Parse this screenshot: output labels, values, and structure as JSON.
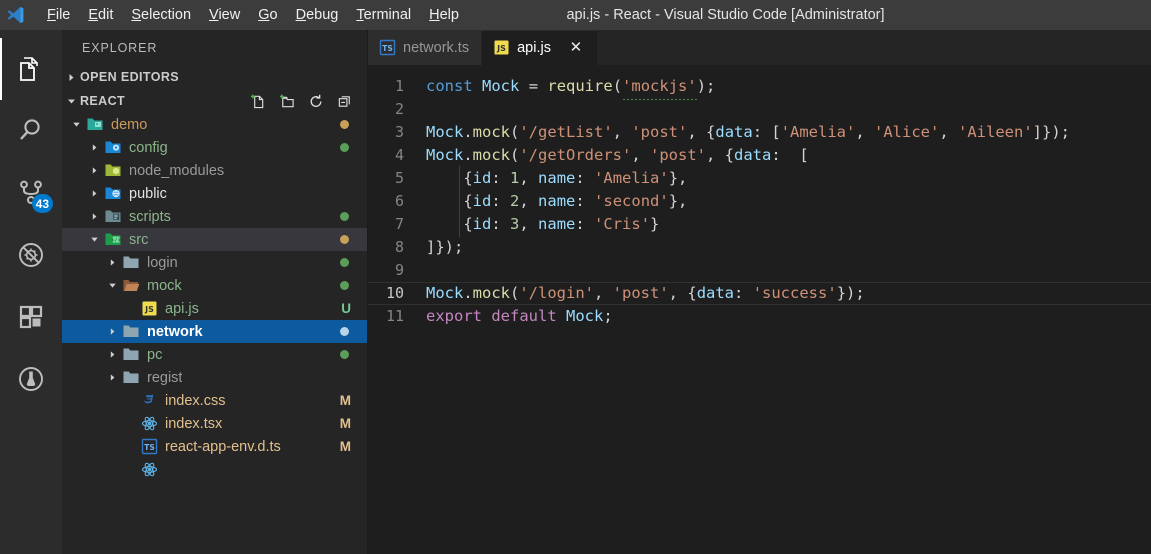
{
  "window": {
    "title": "api.js - React - Visual Studio Code [Administrator]",
    "logo_icon": "vscode-logo-icon"
  },
  "menubar": {
    "items": [
      {
        "label": "File",
        "accel": "F"
      },
      {
        "label": "Edit",
        "accel": "E"
      },
      {
        "label": "Selection",
        "accel": "S"
      },
      {
        "label": "View",
        "accel": "V"
      },
      {
        "label": "Go",
        "accel": "G"
      },
      {
        "label": "Debug",
        "accel": "D"
      },
      {
        "label": "Terminal",
        "accel": "T"
      },
      {
        "label": "Help",
        "accel": "H"
      }
    ]
  },
  "activitybar": {
    "items": [
      {
        "name": "explorer-icon",
        "tooltip": "Explorer",
        "active": true,
        "badge": ""
      },
      {
        "name": "search-icon",
        "tooltip": "Search",
        "active": false,
        "badge": ""
      },
      {
        "name": "source-control-icon",
        "tooltip": "Source Control",
        "active": false,
        "badge": "43"
      },
      {
        "name": "debug-disabled-icon",
        "tooltip": "Debug",
        "active": false,
        "badge": ""
      },
      {
        "name": "extensions-icon",
        "tooltip": "Extensions",
        "active": false,
        "badge": ""
      },
      {
        "name": "test-beaker-icon",
        "tooltip": "Test",
        "active": false,
        "badge": ""
      }
    ],
    "badge_color": "#007acc"
  },
  "sidebar": {
    "title": "EXPLORER",
    "sections": [
      {
        "label": "OPEN EDITORS",
        "expanded": false
      },
      {
        "label": "REACT",
        "expanded": true
      }
    ],
    "section_actions": [
      {
        "name": "new-file-icon",
        "tooltip": "New File"
      },
      {
        "name": "new-folder-icon",
        "tooltip": "New Folder"
      },
      {
        "name": "refresh-icon",
        "tooltip": "Refresh Explorer"
      },
      {
        "name": "collapse-all-icon",
        "tooltip": "Collapse Folders in Explorer"
      }
    ],
    "tree": [
      {
        "label": "demo",
        "type": "folder",
        "icon": "folder-demo-icon",
        "indent": 1,
        "expanded": true,
        "color": "#c99a5b",
        "dot": "#c8a05a",
        "status": ""
      },
      {
        "label": "config",
        "type": "folder",
        "icon": "folder-config-icon",
        "indent": 2,
        "expanded": false,
        "color": "#8bb58b",
        "dot": "#5a9e5a",
        "status": ""
      },
      {
        "label": "node_modules",
        "type": "folder",
        "icon": "folder-node-icon",
        "indent": 2,
        "expanded": false,
        "color": "#9a9a9a",
        "dot": "",
        "status": ""
      },
      {
        "label": "public",
        "type": "folder",
        "icon": "folder-public-icon",
        "indent": 2,
        "expanded": false,
        "color": "#e3e3e3",
        "dot": "",
        "status": ""
      },
      {
        "label": "scripts",
        "type": "folder",
        "icon": "folder-scripts-icon",
        "indent": 2,
        "expanded": false,
        "color": "#8bb58b",
        "dot": "#5a9e5a",
        "status": ""
      },
      {
        "label": "src",
        "type": "folder",
        "icon": "folder-src-icon",
        "indent": 2,
        "expanded": true,
        "color": "#8bb58b",
        "dot": "#c8a05a",
        "status": "",
        "focus": true
      },
      {
        "label": "login",
        "type": "folder",
        "icon": "folder-plain-icon",
        "indent": 3,
        "expanded": false,
        "color": "#9a9a9a",
        "dot": "#5a9e5a",
        "status": ""
      },
      {
        "label": "mock",
        "type": "folder",
        "icon": "folder-open-icon",
        "indent": 3,
        "expanded": true,
        "color": "#8bb58b",
        "dot": "#5a9e5a",
        "status": ""
      },
      {
        "label": "api.js",
        "type": "file",
        "icon": "js-file-icon",
        "indent": 4,
        "expanded": null,
        "color": "#8bb58b",
        "dot": "",
        "status": "U",
        "status_color": "#73c991"
      },
      {
        "label": "network",
        "type": "folder",
        "icon": "folder-plain-icon",
        "indent": 3,
        "expanded": false,
        "color": "#ffffff",
        "dot": "#b8d4e8",
        "status": "",
        "selected": true
      },
      {
        "label": "pc",
        "type": "folder",
        "icon": "folder-plain-icon",
        "indent": 3,
        "expanded": false,
        "color": "#8bb58b",
        "dot": "#5a9e5a",
        "status": ""
      },
      {
        "label": "regist",
        "type": "folder",
        "icon": "folder-plain-icon",
        "indent": 3,
        "expanded": false,
        "color": "#9a9a9a",
        "dot": "",
        "status": ""
      },
      {
        "label": "index.css",
        "type": "file",
        "icon": "css-file-icon",
        "indent": 4,
        "expanded": null,
        "color": "#e2c08d",
        "dot": "",
        "status": "M",
        "status_color": "#e2c08d"
      },
      {
        "label": "index.tsx",
        "type": "file",
        "icon": "react-file-icon",
        "indent": 4,
        "expanded": null,
        "color": "#e2c08d",
        "dot": "",
        "status": "M",
        "status_color": "#e2c08d"
      },
      {
        "label": "react-app-env.d.ts",
        "type": "file",
        "icon": "ts-file-icon",
        "indent": 4,
        "expanded": null,
        "color": "#e2c08d",
        "dot": "",
        "status": "M",
        "status_color": "#e2c08d"
      },
      {
        "label": "",
        "type": "file",
        "icon": "react-file-icon",
        "indent": 4,
        "expanded": null,
        "color": "#e2c08d",
        "dot": "",
        "status": "",
        "status_color": "#e2c08d"
      }
    ]
  },
  "editor": {
    "tabs": [
      {
        "label": "network.ts",
        "icon": "ts-file-icon",
        "active": false,
        "dirty": false,
        "closable": false
      },
      {
        "label": "api.js",
        "icon": "js-file-icon",
        "active": true,
        "dirty": false,
        "closable": true
      }
    ],
    "close_glyph": "✕",
    "active_file": "api.js",
    "current_line": 10,
    "total_lines": 11,
    "lines": [
      {
        "num": 1,
        "guide": false,
        "tokens": [
          {
            "t": "const",
            "c": "t-kw"
          },
          {
            "t": " ",
            "c": "t-plain"
          },
          {
            "t": "Mock",
            "c": "t-var"
          },
          {
            "t": " ",
            "c": "t-plain"
          },
          {
            "t": "=",
            "c": "t-plain"
          },
          {
            "t": " ",
            "c": "t-plain"
          },
          {
            "t": "require",
            "c": "t-fn"
          },
          {
            "t": "(",
            "c": "t-punct"
          },
          {
            "t": "'mockjs'",
            "c": "t-str",
            "warn": true
          },
          {
            "t": ")",
            "c": "t-punct"
          },
          {
            "t": ";",
            "c": "t-punct"
          }
        ]
      },
      {
        "num": 2,
        "guide": false,
        "tokens": []
      },
      {
        "num": 3,
        "guide": false,
        "tokens": [
          {
            "t": "Mock",
            "c": "t-var"
          },
          {
            "t": ".",
            "c": "t-punct"
          },
          {
            "t": "mock",
            "c": "t-fn"
          },
          {
            "t": "(",
            "c": "t-punct"
          },
          {
            "t": "'/getList'",
            "c": "t-str"
          },
          {
            "t": ", ",
            "c": "t-punct"
          },
          {
            "t": "'post'",
            "c": "t-str"
          },
          {
            "t": ", ",
            "c": "t-punct"
          },
          {
            "t": "{",
            "c": "t-punct"
          },
          {
            "t": "data",
            "c": "t-prop"
          },
          {
            "t": ": [",
            "c": "t-punct"
          },
          {
            "t": "'Amelia'",
            "c": "t-str"
          },
          {
            "t": ", ",
            "c": "t-punct"
          },
          {
            "t": "'Alice'",
            "c": "t-str"
          },
          {
            "t": ", ",
            "c": "t-punct"
          },
          {
            "t": "'Aileen'",
            "c": "t-str"
          },
          {
            "t": "]});",
            "c": "t-punct"
          }
        ]
      },
      {
        "num": 4,
        "guide": false,
        "tokens": [
          {
            "t": "Mock",
            "c": "t-var"
          },
          {
            "t": ".",
            "c": "t-punct"
          },
          {
            "t": "mock",
            "c": "t-fn"
          },
          {
            "t": "(",
            "c": "t-punct"
          },
          {
            "t": "'/getOrders'",
            "c": "t-str"
          },
          {
            "t": ", ",
            "c": "t-punct"
          },
          {
            "t": "'post'",
            "c": "t-str"
          },
          {
            "t": ", ",
            "c": "t-punct"
          },
          {
            "t": "{",
            "c": "t-punct"
          },
          {
            "t": "data",
            "c": "t-prop"
          },
          {
            "t": ":  [",
            "c": "t-punct"
          }
        ]
      },
      {
        "num": 5,
        "guide": true,
        "tokens": [
          {
            "t": "    {",
            "c": "t-punct"
          },
          {
            "t": "id",
            "c": "t-prop"
          },
          {
            "t": ": ",
            "c": "t-punct"
          },
          {
            "t": "1",
            "c": "t-num"
          },
          {
            "t": ", ",
            "c": "t-punct"
          },
          {
            "t": "name",
            "c": "t-prop"
          },
          {
            "t": ": ",
            "c": "t-punct"
          },
          {
            "t": "'Amelia'",
            "c": "t-str"
          },
          {
            "t": "},",
            "c": "t-punct"
          }
        ]
      },
      {
        "num": 6,
        "guide": true,
        "tokens": [
          {
            "t": "    {",
            "c": "t-punct"
          },
          {
            "t": "id",
            "c": "t-prop"
          },
          {
            "t": ": ",
            "c": "t-punct"
          },
          {
            "t": "2",
            "c": "t-num"
          },
          {
            "t": ", ",
            "c": "t-punct"
          },
          {
            "t": "name",
            "c": "t-prop"
          },
          {
            "t": ": ",
            "c": "t-punct"
          },
          {
            "t": "'second'",
            "c": "t-str"
          },
          {
            "t": "},",
            "c": "t-punct"
          }
        ]
      },
      {
        "num": 7,
        "guide": true,
        "tokens": [
          {
            "t": "    {",
            "c": "t-punct"
          },
          {
            "t": "id",
            "c": "t-prop"
          },
          {
            "t": ": ",
            "c": "t-punct"
          },
          {
            "t": "3",
            "c": "t-num"
          },
          {
            "t": ", ",
            "c": "t-punct"
          },
          {
            "t": "name",
            "c": "t-prop"
          },
          {
            "t": ": ",
            "c": "t-punct"
          },
          {
            "t": "'Cris'",
            "c": "t-str"
          },
          {
            "t": "}",
            "c": "t-punct"
          }
        ]
      },
      {
        "num": 8,
        "guide": false,
        "tokens": [
          {
            "t": "]});",
            "c": "t-punct"
          }
        ]
      },
      {
        "num": 9,
        "guide": false,
        "tokens": []
      },
      {
        "num": 10,
        "guide": false,
        "current": true,
        "tokens": [
          {
            "t": "Mock",
            "c": "t-var"
          },
          {
            "t": ".",
            "c": "t-punct"
          },
          {
            "t": "mock",
            "c": "t-fn"
          },
          {
            "t": "(",
            "c": "t-punct"
          },
          {
            "t": "'/login'",
            "c": "t-str"
          },
          {
            "t": ", ",
            "c": "t-punct"
          },
          {
            "t": "'post'",
            "c": "t-str"
          },
          {
            "t": ", ",
            "c": "t-punct"
          },
          {
            "t": "{",
            "c": "t-punct"
          },
          {
            "t": "data",
            "c": "t-prop"
          },
          {
            "t": ": ",
            "c": "t-punct"
          },
          {
            "t": "'success'",
            "c": "t-str"
          },
          {
            "t": "});",
            "c": "t-punct"
          }
        ]
      },
      {
        "num": 11,
        "guide": false,
        "tokens": [
          {
            "t": "export",
            "c": "t-kw2"
          },
          {
            "t": " ",
            "c": "t-plain"
          },
          {
            "t": "default",
            "c": "t-kw2"
          },
          {
            "t": " ",
            "c": "t-plain"
          },
          {
            "t": "Mock",
            "c": "t-var"
          },
          {
            "t": ";",
            "c": "t-punct"
          }
        ]
      }
    ]
  },
  "theme": {
    "titlebar_bg": "#3c3c3c",
    "activitybar_bg": "#2c2c2c",
    "sidebar_bg": "#252526",
    "editor_bg": "#1e1e1e",
    "selection_blue": "#0d5a9e",
    "accent": "#007acc"
  }
}
